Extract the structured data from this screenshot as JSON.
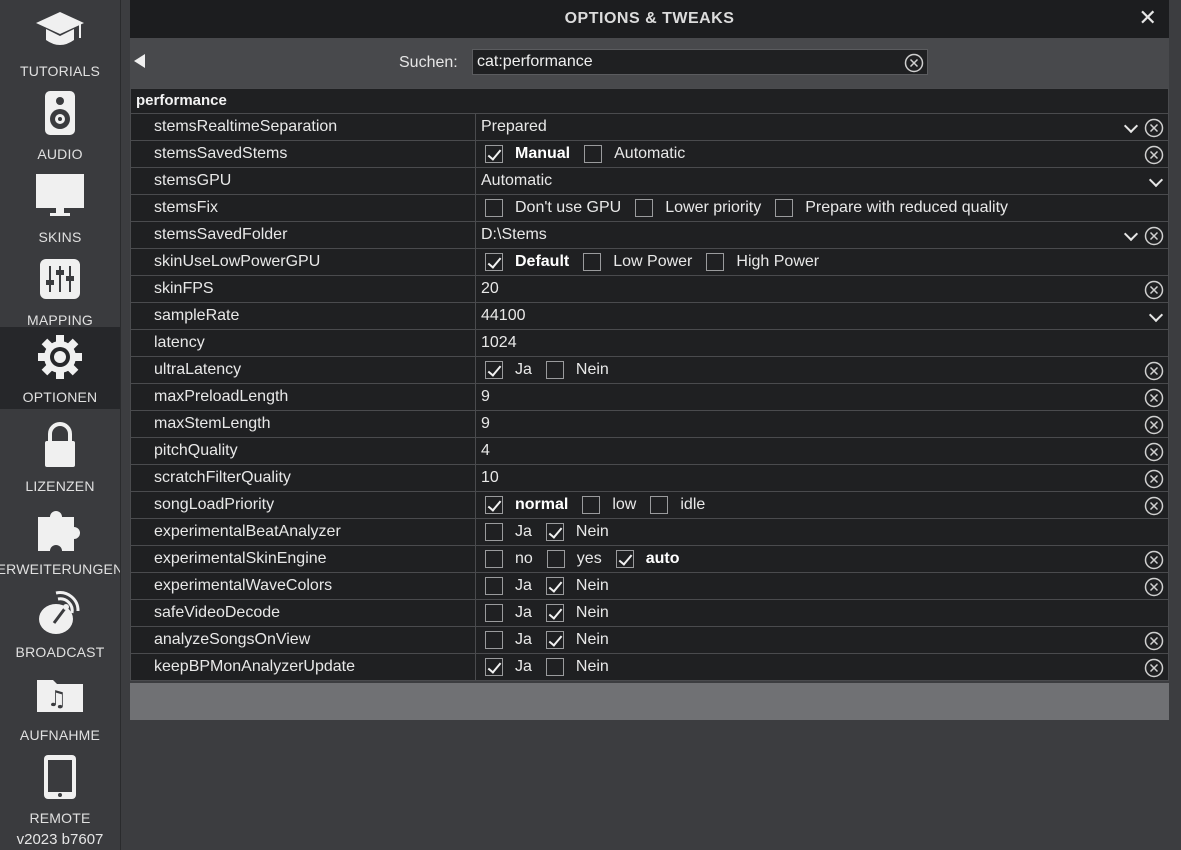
{
  "sidebar": {
    "items": [
      {
        "label": "TUTORIALS",
        "icon": "graduation-cap-icon"
      },
      {
        "label": "AUDIO",
        "icon": "speaker-icon"
      },
      {
        "label": "SKINS",
        "icon": "monitor-icon"
      },
      {
        "label": "MAPPING",
        "icon": "sliders-icon"
      },
      {
        "label": "OPTIONEN",
        "icon": "gear-icon",
        "active": true
      },
      {
        "label": "LIZENZEN",
        "icon": "lock-icon"
      },
      {
        "label": "ERWEITERUNGEN",
        "icon": "puzzle-icon"
      },
      {
        "label": "BROADCAST",
        "icon": "satellite-dish-icon"
      },
      {
        "label": "AUFNAHME",
        "icon": "music-folder-icon"
      },
      {
        "label": "REMOTE",
        "icon": "tablet-icon"
      }
    ],
    "version": "v2023 b7607"
  },
  "header": {
    "title": "OPTIONS & TWEAKS",
    "close": "✕"
  },
  "search": {
    "label": "Suchen:",
    "value": "cat:performance"
  },
  "section": "performance",
  "rows": [
    {
      "name": "stemsRealtimeSeparation",
      "type": "dropdown",
      "value": "Prepared",
      "clear": true
    },
    {
      "name": "stemsSavedStems",
      "type": "checks",
      "options": [
        {
          "label": "Manual",
          "checked": true,
          "bold": true
        },
        {
          "label": "Automatic",
          "checked": false
        }
      ],
      "clear": true
    },
    {
      "name": "stemsGPU",
      "type": "dropdown",
      "value": "Automatic",
      "clear": false
    },
    {
      "name": "stemsFix",
      "type": "checks",
      "options": [
        {
          "label": "Don't use GPU",
          "checked": false
        },
        {
          "label": "Lower priority",
          "checked": false
        },
        {
          "label": "Prepare with reduced quality",
          "checked": false
        }
      ],
      "clear": false
    },
    {
      "name": "stemsSavedFolder",
      "type": "dropdown",
      "value": "D:\\Stems",
      "clear": true
    },
    {
      "name": "skinUseLowPowerGPU",
      "type": "checks",
      "options": [
        {
          "label": "Default",
          "checked": true,
          "bold": true
        },
        {
          "label": "Low Power",
          "checked": false
        },
        {
          "label": "High Power",
          "checked": false
        }
      ],
      "clear": false
    },
    {
      "name": "skinFPS",
      "type": "text",
      "value": "20",
      "clear": true
    },
    {
      "name": "sampleRate",
      "type": "dropdown",
      "value": "44100",
      "clear": false
    },
    {
      "name": "latency",
      "type": "text",
      "value": "1024",
      "clear": false
    },
    {
      "name": "ultraLatency",
      "type": "checks",
      "options": [
        {
          "label": "Ja",
          "checked": true
        },
        {
          "label": "Nein",
          "checked": false
        }
      ],
      "clear": true
    },
    {
      "name": "maxPreloadLength",
      "type": "text",
      "value": "9",
      "clear": true
    },
    {
      "name": "maxStemLength",
      "type": "text",
      "value": "9",
      "clear": true
    },
    {
      "name": "pitchQuality",
      "type": "text",
      "value": "4",
      "clear": true
    },
    {
      "name": "scratchFilterQuality",
      "type": "text",
      "value": "10",
      "clear": true
    },
    {
      "name": "songLoadPriority",
      "type": "checks",
      "options": [
        {
          "label": "normal",
          "checked": true,
          "bold": true
        },
        {
          "label": "low",
          "checked": false
        },
        {
          "label": "idle",
          "checked": false
        }
      ],
      "clear": true
    },
    {
      "name": "experimentalBeatAnalyzer",
      "type": "checks",
      "options": [
        {
          "label": "Ja",
          "checked": false
        },
        {
          "label": "Nein",
          "checked": true
        }
      ],
      "clear": false
    },
    {
      "name": "experimentalSkinEngine",
      "type": "checks",
      "options": [
        {
          "label": "no",
          "checked": false
        },
        {
          "label": "yes",
          "checked": false
        },
        {
          "label": "auto",
          "checked": true,
          "bold": true
        }
      ],
      "clear": true
    },
    {
      "name": "experimentalWaveColors",
      "type": "checks",
      "options": [
        {
          "label": "Ja",
          "checked": false
        },
        {
          "label": "Nein",
          "checked": true
        }
      ],
      "clear": true
    },
    {
      "name": "safeVideoDecode",
      "type": "checks",
      "options": [
        {
          "label": "Ja",
          "checked": false
        },
        {
          "label": "Nein",
          "checked": true
        }
      ],
      "clear": false
    },
    {
      "name": "analyzeSongsOnView",
      "type": "checks",
      "options": [
        {
          "label": "Ja",
          "checked": false
        },
        {
          "label": "Nein",
          "checked": true
        }
      ],
      "clear": true
    },
    {
      "name": "keepBPMonAnalyzerUpdate",
      "type": "checks",
      "options": [
        {
          "label": "Ja",
          "checked": true
        },
        {
          "label": "Nein",
          "checked": false
        }
      ],
      "clear": true
    }
  ]
}
